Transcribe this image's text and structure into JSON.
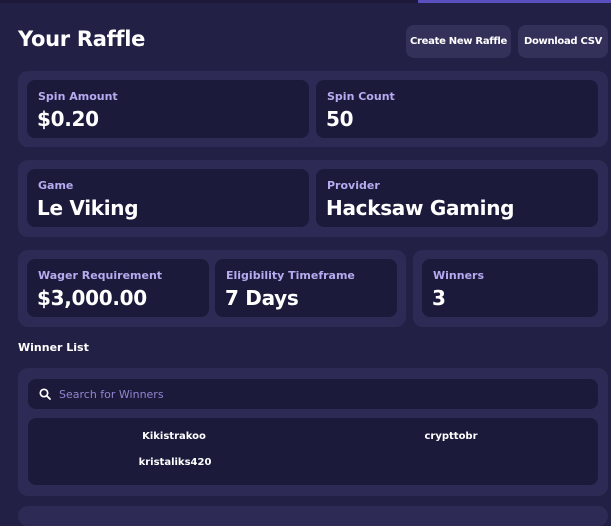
{
  "header": {
    "title": "Your Raffle",
    "create_label": "Create New Raffle",
    "csv_label": "Download CSV"
  },
  "stats": {
    "spin_amount": {
      "label": "Spin Amount",
      "value": "$0.20"
    },
    "spin_count": {
      "label": "Spin Count",
      "value": "50"
    },
    "game": {
      "label": "Game",
      "value": "Le Viking"
    },
    "provider": {
      "label": "Provider",
      "value": "Hacksaw Gaming"
    },
    "wager": {
      "label": "Wager Requirement",
      "value": "$3,000.00"
    },
    "timeframe": {
      "label": "Eligibility Timeframe",
      "value": "7 Days"
    },
    "winners": {
      "label": "Winners",
      "value": "3"
    }
  },
  "winner_list": {
    "title": "Winner List",
    "search_placeholder": "Search for Winners",
    "icon": "search-icon",
    "winners": [
      "Kikistrakoo",
      "crypttobr",
      "kristaliks420"
    ]
  },
  "colors": {
    "background": "#232045",
    "panel": "#2d2a55",
    "card": "#1c1a3a",
    "label": "#b6abf0",
    "accent": "#5a4fbf"
  }
}
